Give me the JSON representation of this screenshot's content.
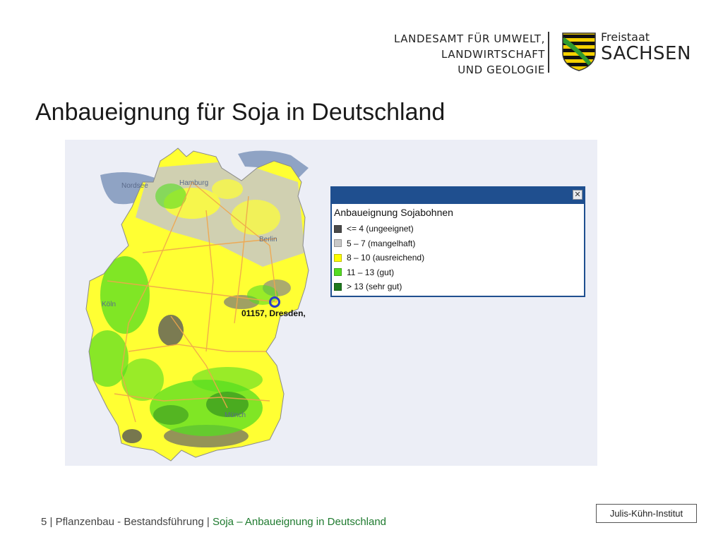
{
  "header": {
    "agency_lines": [
      "LANDESAMT FÜR UMWELT,",
      "LANDWIRTSCHAFT",
      "UND GEOLOGIE"
    ],
    "state_small": "Freistaat",
    "state_big": "SACHSEN",
    "crest_icon": "saxony-coat-of-arms-icon"
  },
  "title": "Anbaueignung für Soja in Deutschland",
  "map": {
    "labels": {
      "nordsee": "Nordsee",
      "hamburg": "Hamburg",
      "berlin": "Berlin",
      "koeln": "Köln",
      "muenchen": "Münch"
    },
    "marker_label": "01157, Dresden,",
    "legend": {
      "title": "Anbaueignung Sojabohnen",
      "close_symbol": "✕",
      "items": [
        {
          "label": "<= 4 (ungeeignet)",
          "color": "#4a4a4a"
        },
        {
          "label": "5 – 7 (mangelhaft)",
          "color": "#c8c8c8"
        },
        {
          "label": "8 – 10 (ausreichend)",
          "color": "#ffff00"
        },
        {
          "label": "11 – 13 (gut)",
          "color": "#55dd22"
        },
        {
          "label": "> 13 (sehr gut)",
          "color": "#1e7a1e"
        }
      ]
    },
    "colors": {
      "sea": "#8fa3c4",
      "background": "#eceef6",
      "roads": "#f0a64c",
      "marker": "#2b3ec8"
    }
  },
  "footer": {
    "page_number": "5",
    "section": "Pflanzenbau - Bestandsführung",
    "topic": "Soja – Anbaueignung in Deutschland",
    "source": "Julis-Kühn-Institut"
  }
}
